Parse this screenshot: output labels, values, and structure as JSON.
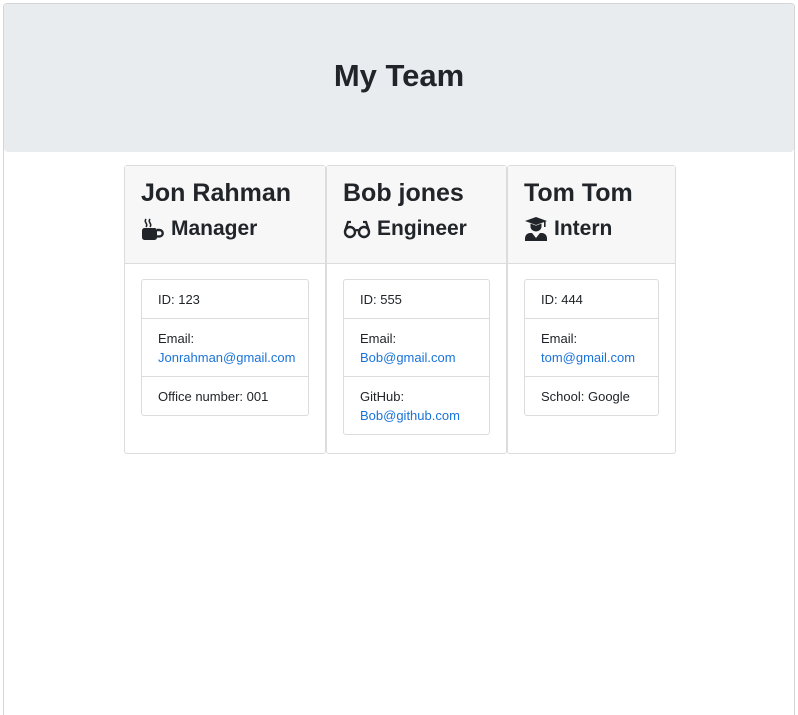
{
  "header": {
    "title": "My Team"
  },
  "employees": [
    {
      "name": "Jon Rahman",
      "role": "Manager",
      "role_icon": "coffee-mug-icon",
      "id_text": "ID: 123",
      "email_label": "Email:",
      "email": "Jonrahman@gmail.com",
      "extra_text": "Office number: 001"
    },
    {
      "name": "Bob jones",
      "role": "Engineer",
      "role_icon": "glasses-icon",
      "id_text": "ID: 555",
      "email_label": "Email:",
      "email": "Bob@gmail.com",
      "extra_label": "GitHub:",
      "extra_link": "Bob@github.com"
    },
    {
      "name": "Tom Tom",
      "role": "Intern",
      "role_icon": "graduate-icon",
      "id_text": "ID: 444",
      "email_label": "Email:",
      "email": "tom@gmail.com",
      "extra_text": "School: Google"
    }
  ],
  "colors": {
    "jumbotron_bg": "#e9ecef",
    "card_header_bg": "#f7f7f7",
    "link": "#1a73d9",
    "text": "#212529"
  }
}
